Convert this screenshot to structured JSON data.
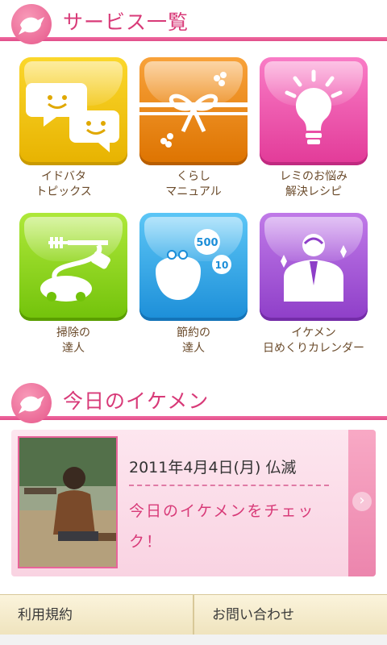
{
  "services_header": {
    "title": "サービス一覧"
  },
  "services": [
    {
      "label1": "イドバタ",
      "label2": "トピックス",
      "color": "#f0c400",
      "icon": "chat-faces-icon"
    },
    {
      "label1": "くらし",
      "label2": "マニュアル",
      "color": "#f08a10",
      "icon": "gift-ribbon-icon"
    },
    {
      "label1": "レミのお悩み",
      "label2": "解決レシピ",
      "color": "#ee4aa8",
      "icon": "lightbulb-icon"
    },
    {
      "label1": "掃除の",
      "label2": "達人",
      "color": "#8ed61a",
      "icon": "vacuum-cleaner-icon"
    },
    {
      "label1": "節約の",
      "label2": "達人",
      "color": "#2aa6e6",
      "icon": "coin-purse-icon"
    },
    {
      "label1": "イケメン",
      "label2": "日めくりカレンダー",
      "color": "#a456d6",
      "icon": "suit-man-icon"
    }
  ],
  "ikemen_header": {
    "title": "今日のイケメン"
  },
  "ikemen_card": {
    "date": "2011年4月4日(月) 仏滅",
    "check": "今日のイケメンをチェック！",
    "arrow": "›"
  },
  "footer": {
    "terms": "利用規約",
    "contact": "お問い合わせ"
  },
  "colors": {
    "accent": "#d83a78",
    "header_line": "#e04d89",
    "footer_bg": "#f6ecd0"
  }
}
